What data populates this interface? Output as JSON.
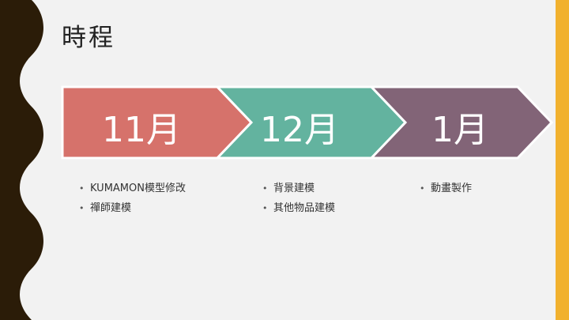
{
  "slide": {
    "title": "時程",
    "colors": {
      "background": "#f2f2f2",
      "left_border": "#2b1c08",
      "right_accent": "#f1b12e",
      "stage_1": "#d6726b",
      "stage_2": "#63b39f",
      "stage_3": "#826477"
    },
    "stages": [
      {
        "label": "11月",
        "items": [
          "KUMAMON模型修改",
          "禪師建模"
        ]
      },
      {
        "label": "12月",
        "items": [
          "背景建模",
          "其他物品建模"
        ]
      },
      {
        "label": "1月",
        "items": [
          "動畫製作"
        ]
      }
    ]
  }
}
